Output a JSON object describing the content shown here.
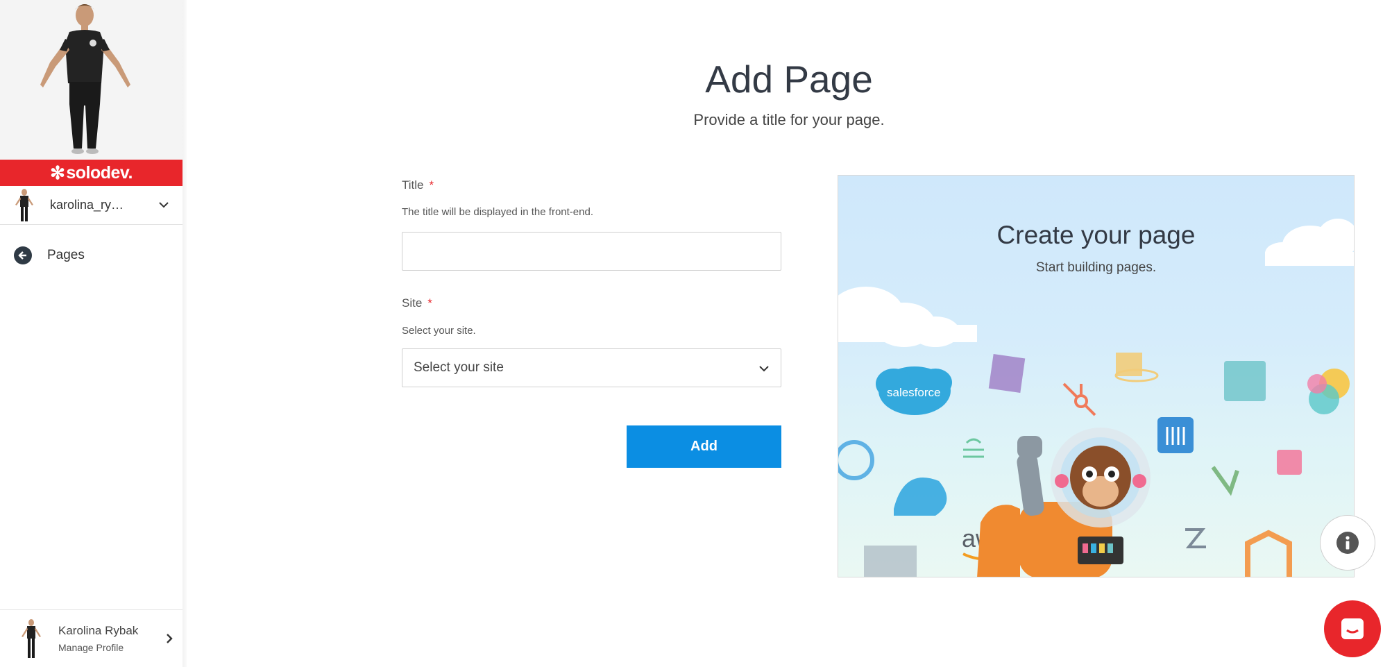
{
  "sidebar": {
    "brand": "solodev.",
    "account_name": "karolina_ry…",
    "nav_back_label": "Pages",
    "profile_name": "Karolina Rybak",
    "profile_sub": "Manage Profile"
  },
  "main": {
    "title": "Add Page",
    "subtitle": "Provide a title for your page.",
    "form": {
      "title_label": "Title",
      "title_required": "*",
      "title_help": "The title will be displayed in the front-end.",
      "title_value": "",
      "site_label": "Site",
      "site_required": "*",
      "site_help": "Select your site.",
      "site_selected": "Select your site",
      "submit_label": "Add"
    },
    "illustration": {
      "title": "Create your page",
      "subtitle": "Start building pages.",
      "logos": [
        "salesforce",
        "aws"
      ]
    }
  },
  "colors": {
    "brand_red": "#e8262b",
    "primary_blue": "#0b8ee3",
    "dark_text": "#333a45"
  },
  "icons": [
    "chevron-down-icon",
    "arrow-left-icon",
    "chevron-right-icon",
    "info-icon",
    "chat-icon"
  ]
}
